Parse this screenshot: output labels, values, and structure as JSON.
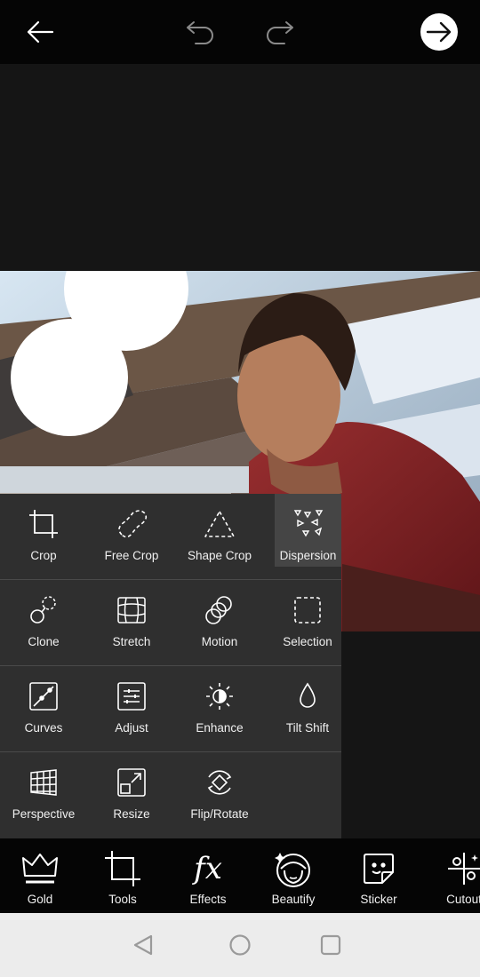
{
  "topbar": {
    "back_icon": "arrow-left-icon",
    "undo_icon": "undo-icon",
    "redo_icon": "redo-icon",
    "next_icon": "arrow-right-circle-icon"
  },
  "tools": {
    "rows": [
      [
        {
          "label": "Crop",
          "icon": "crop-icon"
        },
        {
          "label": "Free Crop",
          "icon": "free-crop-icon"
        },
        {
          "label": "Shape Crop",
          "icon": "shape-crop-icon"
        },
        {
          "label": "Dispersion",
          "icon": "dispersion-icon",
          "active": true
        }
      ],
      [
        {
          "label": "Clone",
          "icon": "clone-icon"
        },
        {
          "label": "Stretch",
          "icon": "stretch-icon"
        },
        {
          "label": "Motion",
          "icon": "motion-icon"
        },
        {
          "label": "Selection",
          "icon": "selection-icon"
        }
      ],
      [
        {
          "label": "Curves",
          "icon": "curves-icon"
        },
        {
          "label": "Adjust",
          "icon": "adjust-icon"
        },
        {
          "label": "Enhance",
          "icon": "enhance-icon"
        },
        {
          "label": "Tilt Shift",
          "icon": "tilt-shift-icon"
        }
      ],
      [
        {
          "label": "Perspective",
          "icon": "perspective-icon"
        },
        {
          "label": "Resize",
          "icon": "resize-icon"
        },
        {
          "label": "Flip/Rotate",
          "icon": "flip-rotate-icon"
        }
      ]
    ]
  },
  "bottom_nav": {
    "items": [
      {
        "label": "Gold",
        "icon": "crown-icon"
      },
      {
        "label": "Tools",
        "icon": "crop-tools-icon"
      },
      {
        "label": "Effects",
        "icon": "fx-icon"
      },
      {
        "label": "Beautify",
        "icon": "beautify-icon"
      },
      {
        "label": "Sticker",
        "icon": "sticker-icon"
      },
      {
        "label": "Cutout",
        "icon": "cutout-icon"
      }
    ]
  },
  "system_nav": {
    "back_icon": "nav-back-icon",
    "home_icon": "nav-home-icon",
    "recents_icon": "nav-recents-icon"
  },
  "colors": {
    "bar_bg": "#050505",
    "panel_bg": "#2f2f2f",
    "active_tool_bg": "#454545",
    "canvas_bg": "#151515"
  }
}
